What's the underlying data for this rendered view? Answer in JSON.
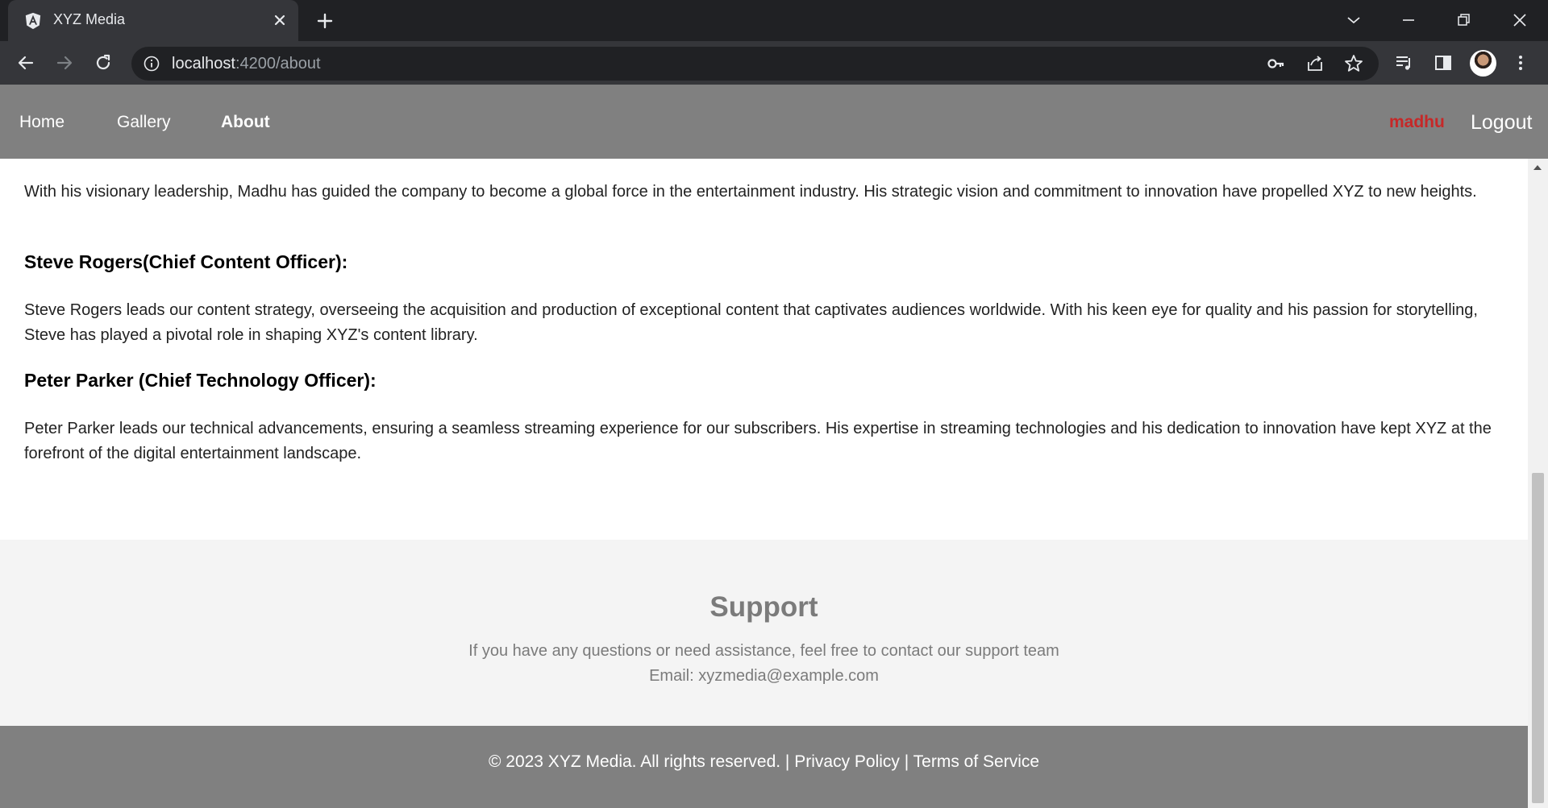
{
  "browser": {
    "tab_title": "XYZ Media",
    "url_host": "localhost",
    "url_rest": ":4200/about"
  },
  "nav": {
    "home": "Home",
    "gallery": "Gallery",
    "about": "About",
    "user": "madhu",
    "logout": "Logout"
  },
  "content": {
    "intro_paragraph": "With his visionary leadership, Madhu has guided the company to become a global force in the entertainment industry. His strategic vision and commitment to innovation have propelled XYZ to new heights.",
    "members": [
      {
        "heading": "Steve Rogers(Chief Content Officer):",
        "bio": "Steve Rogers leads our content strategy, overseeing the acquisition and production of exceptional content that captivates audiences worldwide. With his keen eye for quality and his passion for storytelling, Steve has played a pivotal role in shaping XYZ's content library."
      },
      {
        "heading": "Peter Parker (Chief Technology Officer):",
        "bio": "Peter Parker leads our technical advancements, ensuring a seamless streaming experience for our subscribers. His expertise in streaming technologies and his dedication to innovation have kept XYZ at the forefront of the digital entertainment landscape."
      }
    ]
  },
  "support": {
    "title": "Support",
    "line1": "If you have any questions or need assistance, feel free to contact our support team",
    "line2": "Email: xyzmedia@example.com"
  },
  "footer": {
    "copyright": "© 2023 XYZ Media. All rights reserved. | ",
    "privacy": "Privacy Policy",
    "separator": " | ",
    "terms": "Terms of Service"
  },
  "colors": {
    "nav_bg": "#808080",
    "user_accent": "#c62828",
    "support_bg": "#f4f4f4"
  }
}
